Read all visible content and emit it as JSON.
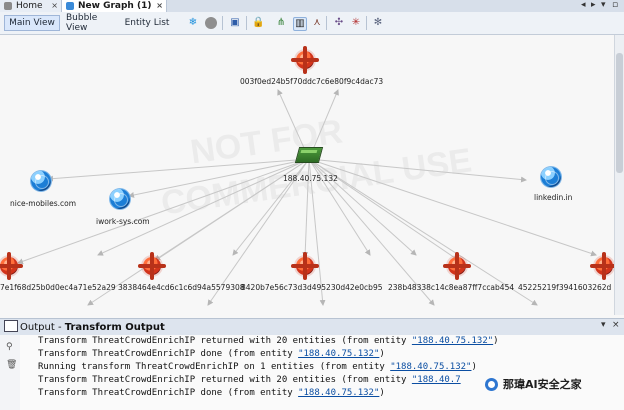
{
  "tabs": {
    "home": "Home",
    "new_graph": "New Graph (1)"
  },
  "toolbar": {
    "main_view": "Main View",
    "bubble_view": "Bubble View",
    "entity_list": "Entity List"
  },
  "graph": {
    "watermark_line1": "NOT FOR",
    "watermark_line2": "COMMERCIAL USE",
    "nodes": {
      "top_hash": "003f0ed24b5f70ddc7c6e80f9c4dac73",
      "center_ip": "188.40.75.132",
      "left_domain": "nice-mobiles.com",
      "mid_domain": "iwork-sys.com",
      "right_domain": "linkedin.in",
      "bottom_1": "7e1f68d25b0d0ec4a71e52a29",
      "bottom_2": "3838464e4cd6c1c6d94a5579308",
      "bottom_3": "8420b7e56c73d3d495230d42e0cb95",
      "bottom_4": "238b48338c14c8ea87ff7ccab454",
      "bottom_5": "45225219f3941603262d"
    }
  },
  "output": {
    "title_prefix": "Output",
    "title_suffix": "Transform Output",
    "lines": [
      {
        "before": "Transform ThreatCrowdEnrichIP returned with 20 entities (from entity ",
        "link": "\"188.40.75.132\"",
        "after": ")"
      },
      {
        "before": "Transform ThreatCrowdEnrichIP done (from entity ",
        "link": "\"188.40.75.132\"",
        "after": ")"
      },
      {
        "before": "Running transform ThreatCrowdEnrichIP on 1 entities (from entity ",
        "link": "\"188.40.75.132\"",
        "after": ")"
      },
      {
        "before": "Transform ThreatCrowdEnrichIP returned with 20 entities (from entity ",
        "link": "\"188.40.7",
        "after": ""
      },
      {
        "before": "Transform ThreatCrowdEnrichIP done (from entity ",
        "link": "\"188.40.75.132\"",
        "after": ")"
      }
    ]
  },
  "brand": {
    "text": "那瑋AI安全之家"
  }
}
